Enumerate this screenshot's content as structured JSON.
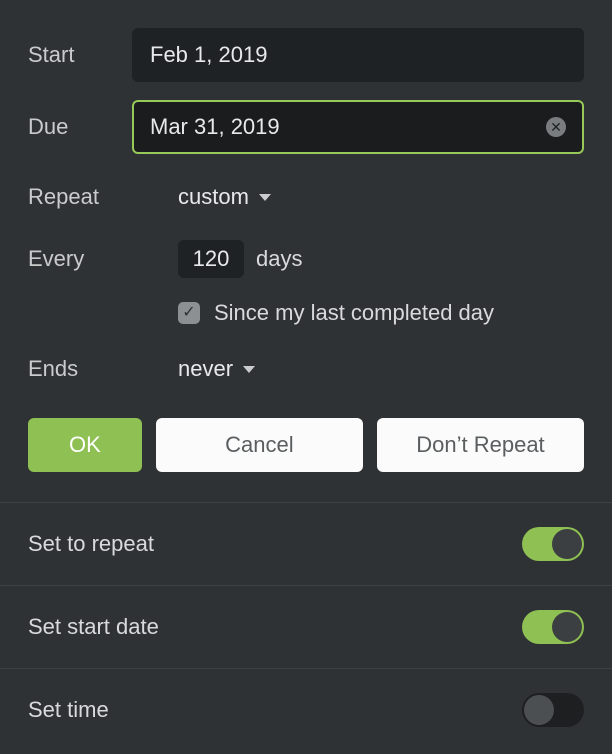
{
  "start": {
    "label": "Start",
    "value": "Feb 1, 2019"
  },
  "due": {
    "label": "Due",
    "value": "Mar 31, 2019"
  },
  "repeat": {
    "label": "Repeat",
    "value": "custom"
  },
  "every": {
    "label": "Every",
    "value": "120",
    "unit": "days"
  },
  "since": {
    "checked": true,
    "label": "Since my last completed day"
  },
  "ends": {
    "label": "Ends",
    "value": "never"
  },
  "buttons": {
    "ok": "OK",
    "cancel": "Cancel",
    "dont": "Don’t Repeat"
  },
  "toggles": {
    "repeat": {
      "label": "Set to repeat",
      "on": true
    },
    "start": {
      "label": "Set start date",
      "on": true
    },
    "time": {
      "label": "Set time",
      "on": false
    }
  }
}
